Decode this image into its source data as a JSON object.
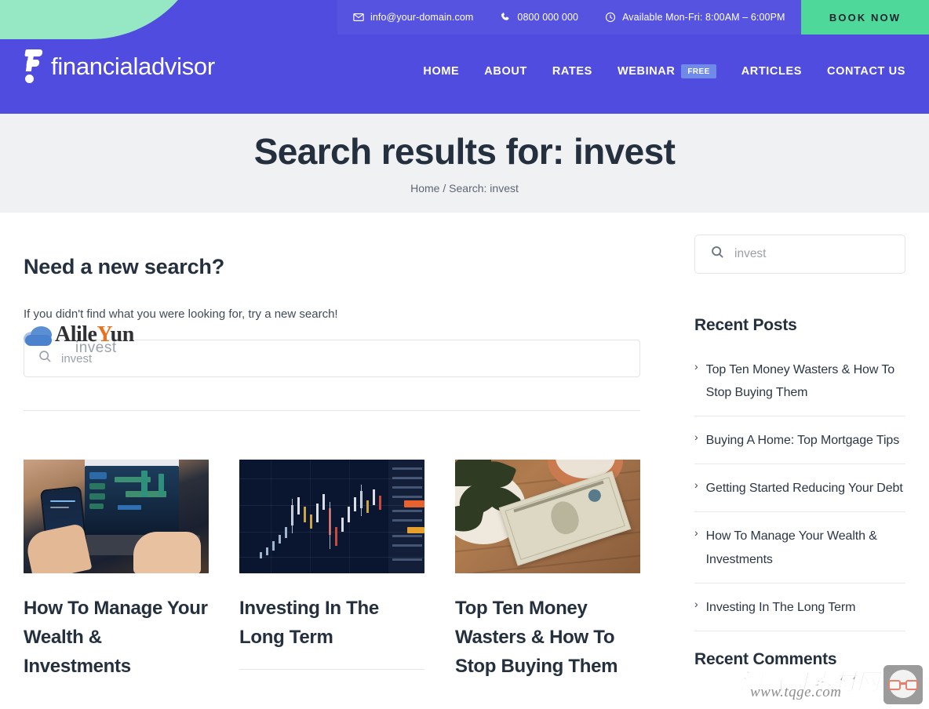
{
  "header": {
    "topbar": {
      "email": "info@your-domain.com",
      "phone": "0800 000 000",
      "hours": "Available Mon-Fri: 8:00AM – 6:00PM",
      "book_now": "BOOK NOW"
    },
    "logo_text": "financialadvisor",
    "nav": [
      {
        "label": "HOME",
        "badge": null
      },
      {
        "label": "ABOUT",
        "badge": null
      },
      {
        "label": "RATES",
        "badge": null
      },
      {
        "label": "WEBINAR",
        "badge": "FREE"
      },
      {
        "label": "ARTICLES",
        "badge": null
      },
      {
        "label": "CONTACT US",
        "badge": null
      }
    ]
  },
  "hero": {
    "title": "Search results for: invest",
    "breadcrumb_home": "Home",
    "breadcrumb_sep": " / ",
    "breadcrumb_current": "Search: invest"
  },
  "content": {
    "need_title": "Need a new search?",
    "need_sub": "If you didn't find what you were looking for, try a new search!",
    "search_placeholder": "invest",
    "search_value": ""
  },
  "watermark_search": {
    "main_a": "Alile",
    "main_y": "Y",
    "main_b": "un",
    "sub": "invest"
  },
  "cards": [
    {
      "title": "How To Manage Your Wealth & Investments",
      "image": "phone-trading-charts-photo",
      "has_rule": false
    },
    {
      "title": "Investing In The Long Term",
      "image": "dark-candlestick-chart-photo",
      "has_rule": true
    },
    {
      "title": "Top Ten Money Wasters & How To Stop Buying Them",
      "image": "dollar-bill-on-wood-photo",
      "has_rule": false
    }
  ],
  "sidebar": {
    "search_placeholder": "invest",
    "search_value": "",
    "recent_posts_heading": "Recent Posts",
    "recent_posts": [
      "Top Ten Money Wasters & How To Stop Buying Them",
      "Buying A Home: Top Mortgage Tips",
      "Getting Started Reducing Your Debt",
      "How To Manage Your Wealth & Investments",
      "Investing In The Long Term"
    ],
    "recent_comments_heading": "Recent Comments",
    "chevron": "›"
  },
  "watermark_tqge": {
    "cn_text": "淘气哥素材网",
    "url_text": "www.tqge.com"
  },
  "colors": {
    "header_blue": "#504ce0",
    "accent_green": "#96e8c5",
    "button_green": "#4ed99b",
    "badge_blue": "#6f8ae8",
    "hero_bg": "#f0f1f3",
    "text_dark": "#25303f",
    "watermark_orange": "#e8721f"
  }
}
